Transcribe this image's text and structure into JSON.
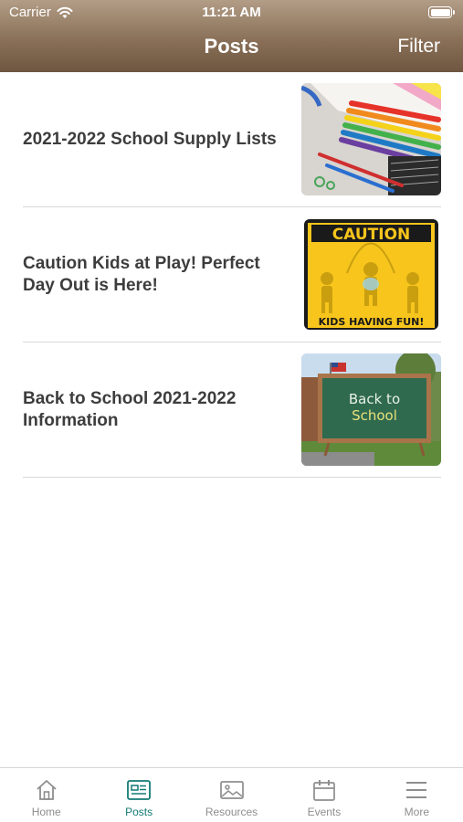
{
  "status_bar": {
    "carrier": "Carrier",
    "time": "11:21 AM"
  },
  "header": {
    "title": "Posts",
    "filter_label": "Filter"
  },
  "posts": [
    {
      "title": "2021-2022 School Supply Lists",
      "image_icon": "school-supplies-image"
    },
    {
      "title": "Caution Kids at Play! Perfect Day Out is Here!",
      "image_icon": "caution-sign-image",
      "image_text_top": "CAUTION",
      "image_text_bottom": "KIDS HAVING FUN!"
    },
    {
      "title": "Back to School 2021-2022 Information",
      "image_icon": "chalkboard-image",
      "image_text_line1": "Back to",
      "image_text_line2": "School"
    }
  ],
  "tabbar": {
    "items": [
      {
        "label": "Home",
        "icon": "home-icon"
      },
      {
        "label": "Posts",
        "icon": "posts-icon",
        "active": true
      },
      {
        "label": "Resources",
        "icon": "image-icon"
      },
      {
        "label": "Events",
        "icon": "calendar-icon"
      },
      {
        "label": "More",
        "icon": "menu-icon"
      }
    ]
  },
  "colors": {
    "header": "#8a7058",
    "active_tab": "#137a74",
    "inactive_tab": "#8e8e8e",
    "caution_yellow": "#f7c51c"
  }
}
